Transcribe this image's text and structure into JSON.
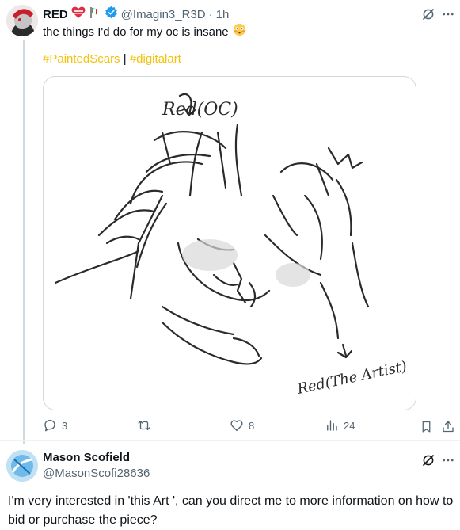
{
  "tweet": {
    "author_name": "RED",
    "author_handle": "@Imagin3_R3D",
    "time": "1h",
    "text": "the things I'd do for my oc is insane",
    "hashtags": [
      "#PaintedScars",
      "#digitalart"
    ],
    "hashtag_separator": "|",
    "media_texts": {
      "label_top": "Red(OC)",
      "label_bottom": "Red(The Artist)"
    },
    "stats": {
      "replies": "3",
      "retweets": "",
      "likes": "8",
      "views": "24"
    }
  },
  "reply": {
    "author_name": "Mason Scofield",
    "author_handle": "@MasonScofi28636",
    "text": "I'm very interested in 'this Art ', can you direct me to more information on how to bid or purchase the piece?"
  },
  "colors": {
    "hashtag": "#f4c20d",
    "verified": "#1d9bf0",
    "muted": "#536471"
  },
  "icons": [
    "heart-emoji-icon",
    "flag-emoji-icon",
    "verified-badge-icon",
    "flushed-emoji-icon",
    "grok-icon",
    "more-icon",
    "reply-icon",
    "retweet-icon",
    "like-icon",
    "views-icon",
    "bookmark-icon",
    "share-icon"
  ]
}
